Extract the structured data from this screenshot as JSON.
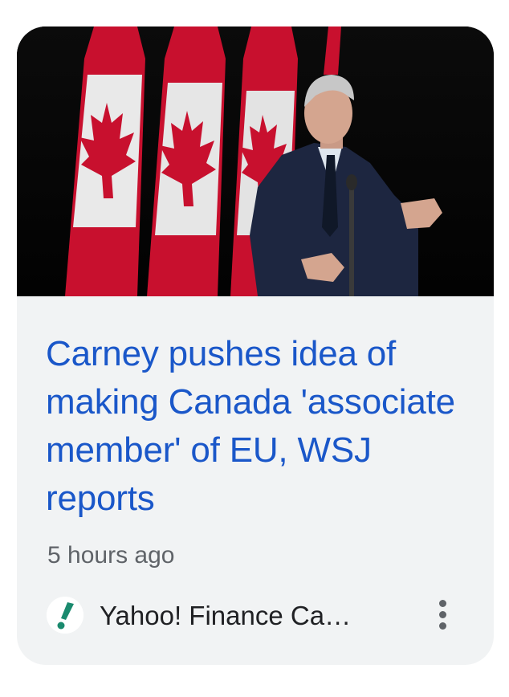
{
  "article": {
    "headline": "Carney pushes idea of making Canada 'associate member' of EU, WSJ reports",
    "timestamp": "5 hours ago",
    "source_name": "Yahoo! Finance Cana...",
    "image_icon": "news-photo",
    "source_icon": "yahoo-exclamation-icon",
    "more_icon": "more-vert-icon"
  },
  "colors": {
    "headline": "#1a57c9",
    "card_background": "#f1f3f4",
    "timestamp": "#5f6368",
    "source_text": "#202124",
    "source_logo": "#1a8a6e"
  }
}
